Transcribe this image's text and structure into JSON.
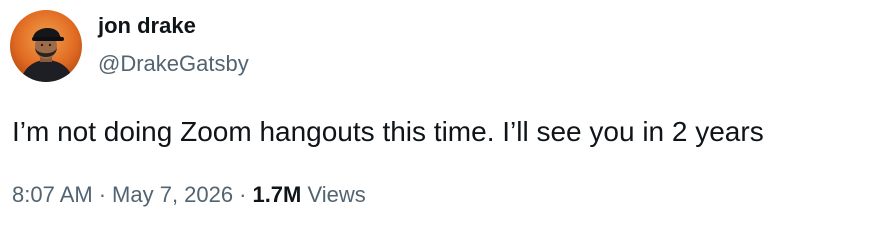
{
  "author": {
    "display_name": "jon drake",
    "handle": "@DrakeGatsby",
    "avatar_icon": "profile-photo"
  },
  "tweet": {
    "text": "I’m not doing Zoom hangouts this time. I’ll see you in 2 years",
    "time": "8:07 AM",
    "separator": "·",
    "date": "May 7, 2026",
    "views_count": "1.7M",
    "views_label": "Views"
  },
  "colors": {
    "text_primary": "#0f1419",
    "text_secondary": "#536471",
    "background": "#ffffff",
    "avatar_background": "#e8742a"
  }
}
